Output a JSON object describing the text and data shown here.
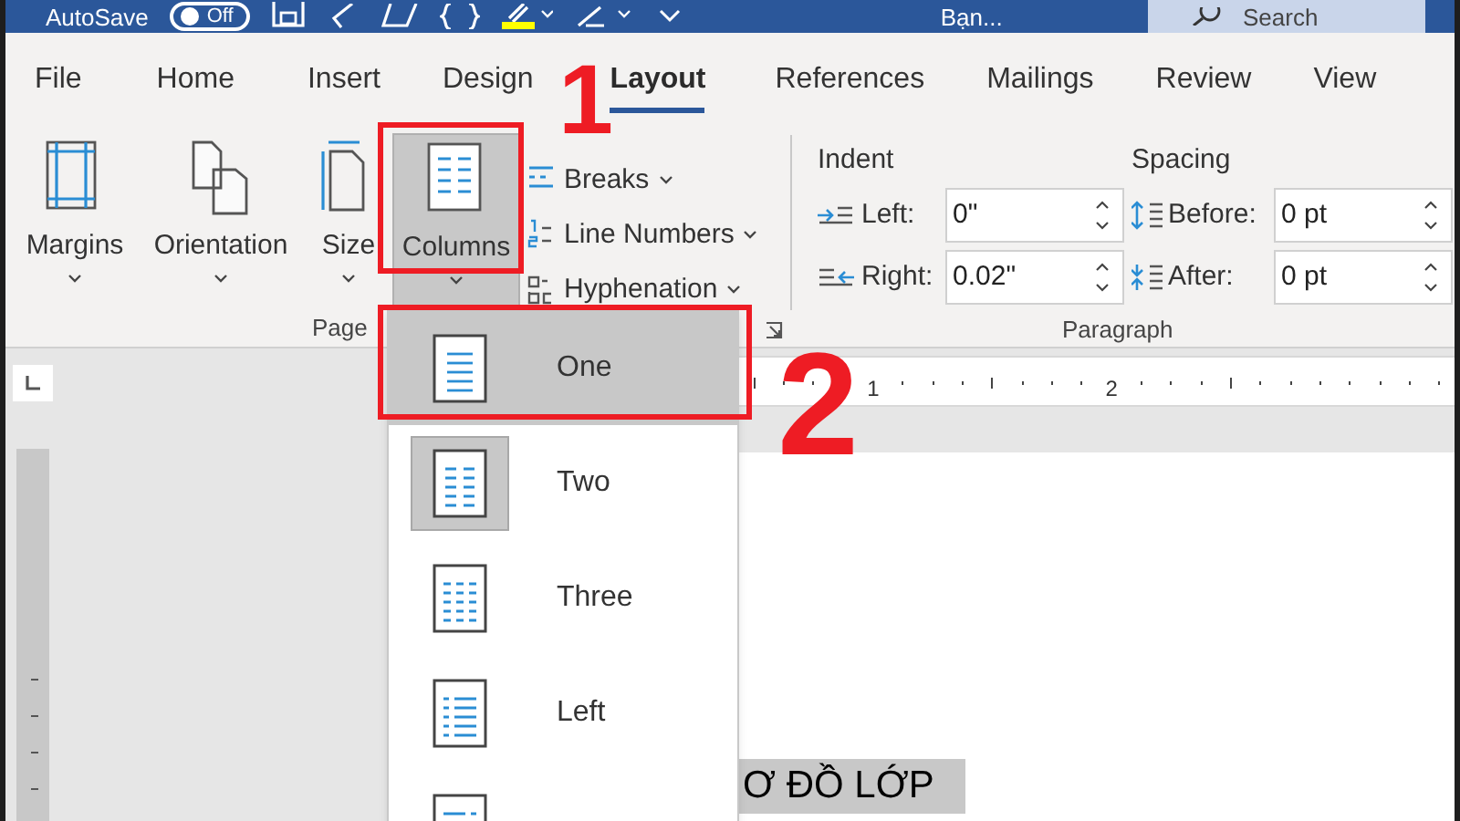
{
  "title_bar": {
    "autosave_label": "AutoSave",
    "autosave_toggle": {
      "label": "Off",
      "on": false
    },
    "document_name": "Bạn...",
    "search_placeholder": "Search"
  },
  "tabs": [
    {
      "label": "File",
      "selected": false
    },
    {
      "label": "Home",
      "selected": false
    },
    {
      "label": "Insert",
      "selected": false
    },
    {
      "label": "Design",
      "selected": false
    },
    {
      "label": "Layout",
      "selected": true
    },
    {
      "label": "References",
      "selected": false
    },
    {
      "label": "Mailings",
      "selected": false
    },
    {
      "label": "Review",
      "selected": false
    },
    {
      "label": "View",
      "selected": false
    }
  ],
  "page_setup": {
    "large_buttons": [
      {
        "kind": "margins",
        "label": "Margins",
        "pressed": false
      },
      {
        "kind": "orientation",
        "label": "Orientation",
        "pressed": false
      },
      {
        "kind": "size",
        "label": "Size",
        "pressed": false
      },
      {
        "kind": "columns",
        "label": "Columns",
        "pressed": true
      }
    ],
    "small_buttons": [
      {
        "kind": "breaks",
        "label": "Breaks"
      },
      {
        "kind": "line_numbers",
        "label": "Line Numbers"
      },
      {
        "kind": "hyphenation",
        "label": "Hyphenation"
      }
    ],
    "group_label": "Page"
  },
  "paragraph": {
    "indent_heading": "Indent",
    "spacing_heading": "Spacing",
    "indent": [
      {
        "kind": "left",
        "label": "Left:",
        "value": "0\""
      },
      {
        "kind": "right",
        "label": "Right:",
        "value": "0.02\""
      }
    ],
    "spacing": [
      {
        "kind": "before",
        "label": "Before:",
        "value": "0 pt"
      },
      {
        "kind": "after",
        "label": "After:",
        "value": "0 pt"
      }
    ],
    "group_label": "Paragraph"
  },
  "ruler": {
    "marks": [
      "1",
      "2"
    ]
  },
  "columns_menu": [
    {
      "kind": "one",
      "label": "One",
      "selected": true,
      "current": false
    },
    {
      "kind": "two",
      "label": "Two",
      "selected": false,
      "current": true
    },
    {
      "kind": "three",
      "label": "Three",
      "selected": false,
      "current": false
    },
    {
      "kind": "left",
      "label": "Left",
      "selected": false,
      "current": false
    },
    {
      "kind": "right",
      "selected": false,
      "current": false
    }
  ],
  "document_text": "Ơ ĐỒ LỚP",
  "annotations": [
    {
      "number": "1"
    },
    {
      "number": "2"
    }
  ]
}
